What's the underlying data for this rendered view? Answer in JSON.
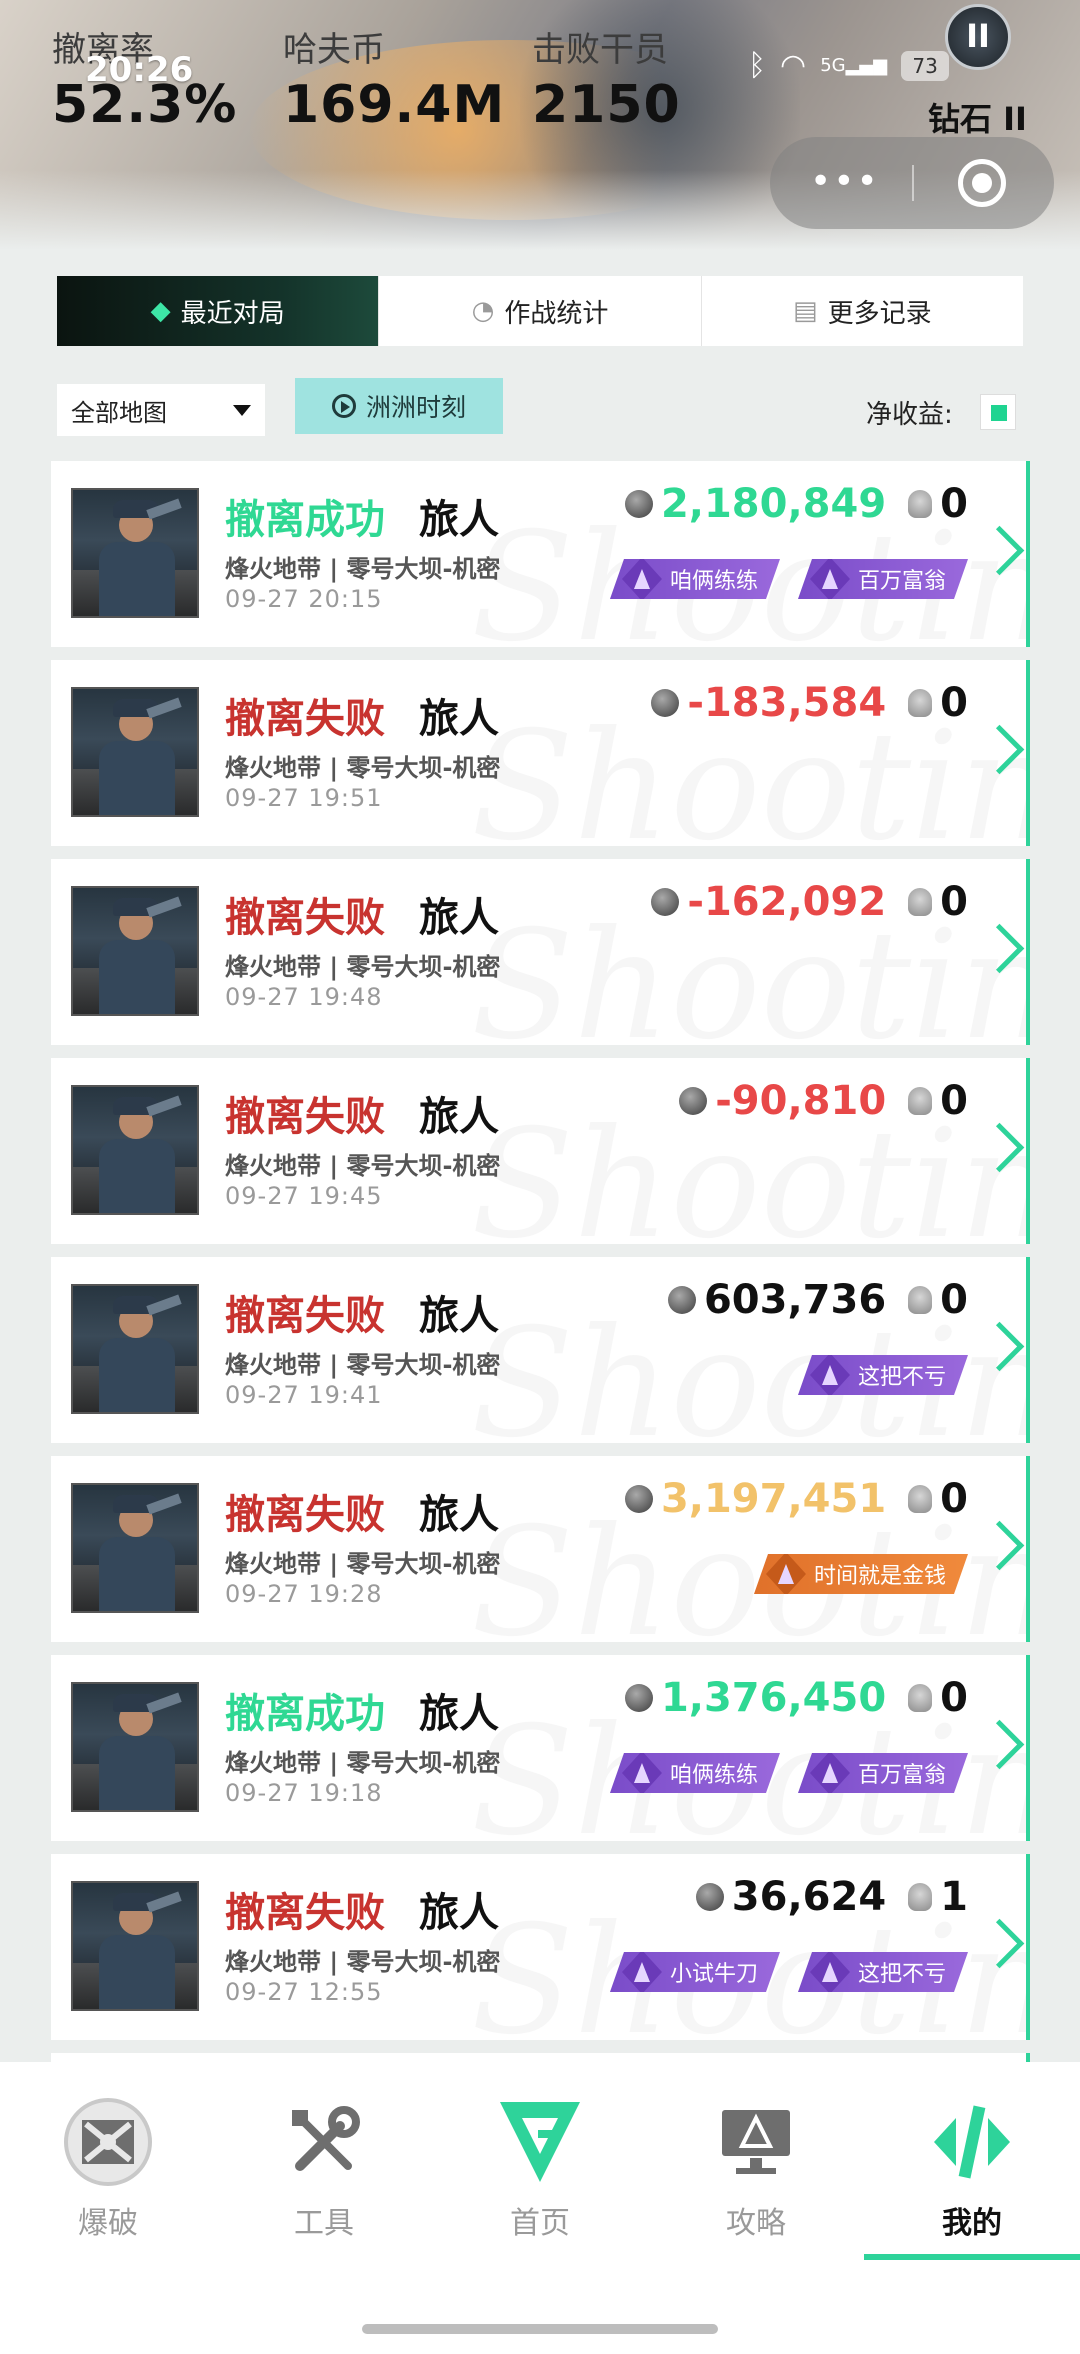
{
  "header": {
    "stats": [
      {
        "label": "撤离率",
        "value": "52.3%"
      },
      {
        "label": "哈夫币",
        "value": "169.4M"
      },
      {
        "label": "击败干员",
        "value": "2150"
      }
    ],
    "clock": "20:26",
    "signal": "5G",
    "battery": "73",
    "rank_roman": "II",
    "rank_label": "钻石 II",
    "capsule_dots": "•••"
  },
  "tabs": [
    {
      "label": "最近对局",
      "icon": "gamepad-icon"
    },
    {
      "label": "作战统计",
      "icon": "pie-chart-icon"
    },
    {
      "label": "更多记录",
      "icon": "document-icon"
    }
  ],
  "filters": {
    "map": "全部地图",
    "moment": "洲洲时刻",
    "net_label": "净收益:"
  },
  "matches": [
    {
      "status": "撤离成功",
      "result": "ok",
      "player": "旅人",
      "map": "烽火地带 | 零号大坝-机密",
      "time": "09-27 20:15",
      "amount": "2,180,849",
      "tone": "pos-green",
      "kills": "0",
      "badges": [
        {
          "text": "咱俩练练",
          "color": "purple"
        },
        {
          "text": "百万富翁",
          "color": "purple"
        }
      ]
    },
    {
      "status": "撤离失败",
      "result": "fail",
      "player": "旅人",
      "map": "烽火地带 | 零号大坝-机密",
      "time": "09-27 19:51",
      "amount": "-183,584",
      "tone": "neg",
      "kills": "0",
      "badges": []
    },
    {
      "status": "撤离失败",
      "result": "fail",
      "player": "旅人",
      "map": "烽火地带 | 零号大坝-机密",
      "time": "09-27 19:48",
      "amount": "-162,092",
      "tone": "neg",
      "kills": "0",
      "badges": []
    },
    {
      "status": "撤离失败",
      "result": "fail",
      "player": "旅人",
      "map": "烽火地带 | 零号大坝-机密",
      "time": "09-27 19:45",
      "amount": "-90,810",
      "tone": "neg",
      "kills": "0",
      "badges": []
    },
    {
      "status": "撤离失败",
      "result": "fail",
      "player": "旅人",
      "map": "烽火地带 | 零号大坝-机密",
      "time": "09-27 19:41",
      "amount": "603,736",
      "tone": "plain",
      "kills": "0",
      "badges": [
        {
          "text": "这把不亏",
          "color": "purple"
        }
      ]
    },
    {
      "status": "撤离失败",
      "result": "fail",
      "player": "旅人",
      "map": "烽火地带 | 零号大坝-机密",
      "time": "09-27 19:28",
      "amount": "3,197,451",
      "tone": "gold",
      "kills": "0",
      "badges": [
        {
          "text": "时间就是金钱",
          "color": "orange"
        }
      ]
    },
    {
      "status": "撤离成功",
      "result": "ok",
      "player": "旅人",
      "map": "烽火地带 | 零号大坝-机密",
      "time": "09-27 19:18",
      "amount": "1,376,450",
      "tone": "pos-green",
      "kills": "0",
      "badges": [
        {
          "text": "咱俩练练",
          "color": "purple"
        },
        {
          "text": "百万富翁",
          "color": "purple"
        }
      ]
    },
    {
      "status": "撤离失败",
      "result": "fail",
      "player": "旅人",
      "map": "烽火地带 | 零号大坝-机密",
      "time": "09-27 12:55",
      "amount": "36,624",
      "tone": "plain",
      "kills": "1",
      "badges": [
        {
          "text": "小试牛刀",
          "color": "purple"
        },
        {
          "text": "这把不亏",
          "color": "purple"
        }
      ]
    }
  ],
  "bottom_nav": [
    {
      "label": "爆破",
      "icon": "demolition-icon"
    },
    {
      "label": "工具",
      "icon": "tools-icon"
    },
    {
      "label": "首页",
      "icon": "home-logo-icon"
    },
    {
      "label": "攻略",
      "icon": "guide-icon"
    },
    {
      "label": "我的",
      "icon": "profile-icon",
      "active": true
    }
  ],
  "colors": {
    "accent": "#2ed39a",
    "fail": "#c8332f",
    "negative": "#e84848",
    "gold": "#f2c26a",
    "badge_purple": "#8a5ad2",
    "badge_orange": "#e8792f"
  }
}
